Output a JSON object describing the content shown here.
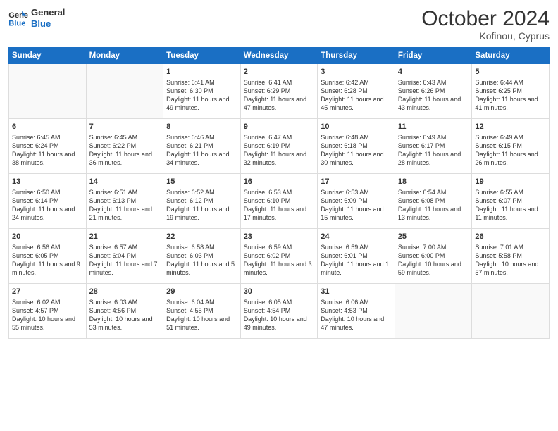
{
  "header": {
    "logo_line1": "General",
    "logo_line2": "Blue",
    "month": "October 2024",
    "location": "Kofinou, Cyprus"
  },
  "days_of_week": [
    "Sunday",
    "Monday",
    "Tuesday",
    "Wednesday",
    "Thursday",
    "Friday",
    "Saturday"
  ],
  "weeks": [
    [
      {
        "day": "",
        "info": ""
      },
      {
        "day": "",
        "info": ""
      },
      {
        "day": "1",
        "info": "Sunrise: 6:41 AM\nSunset: 6:30 PM\nDaylight: 11 hours and 49 minutes."
      },
      {
        "day": "2",
        "info": "Sunrise: 6:41 AM\nSunset: 6:29 PM\nDaylight: 11 hours and 47 minutes."
      },
      {
        "day": "3",
        "info": "Sunrise: 6:42 AM\nSunset: 6:28 PM\nDaylight: 11 hours and 45 minutes."
      },
      {
        "day": "4",
        "info": "Sunrise: 6:43 AM\nSunset: 6:26 PM\nDaylight: 11 hours and 43 minutes."
      },
      {
        "day": "5",
        "info": "Sunrise: 6:44 AM\nSunset: 6:25 PM\nDaylight: 11 hours and 41 minutes."
      }
    ],
    [
      {
        "day": "6",
        "info": "Sunrise: 6:45 AM\nSunset: 6:24 PM\nDaylight: 11 hours and 38 minutes."
      },
      {
        "day": "7",
        "info": "Sunrise: 6:45 AM\nSunset: 6:22 PM\nDaylight: 11 hours and 36 minutes."
      },
      {
        "day": "8",
        "info": "Sunrise: 6:46 AM\nSunset: 6:21 PM\nDaylight: 11 hours and 34 minutes."
      },
      {
        "day": "9",
        "info": "Sunrise: 6:47 AM\nSunset: 6:19 PM\nDaylight: 11 hours and 32 minutes."
      },
      {
        "day": "10",
        "info": "Sunrise: 6:48 AM\nSunset: 6:18 PM\nDaylight: 11 hours and 30 minutes."
      },
      {
        "day": "11",
        "info": "Sunrise: 6:49 AM\nSunset: 6:17 PM\nDaylight: 11 hours and 28 minutes."
      },
      {
        "day": "12",
        "info": "Sunrise: 6:49 AM\nSunset: 6:15 PM\nDaylight: 11 hours and 26 minutes."
      }
    ],
    [
      {
        "day": "13",
        "info": "Sunrise: 6:50 AM\nSunset: 6:14 PM\nDaylight: 11 hours and 24 minutes."
      },
      {
        "day": "14",
        "info": "Sunrise: 6:51 AM\nSunset: 6:13 PM\nDaylight: 11 hours and 21 minutes."
      },
      {
        "day": "15",
        "info": "Sunrise: 6:52 AM\nSunset: 6:12 PM\nDaylight: 11 hours and 19 minutes."
      },
      {
        "day": "16",
        "info": "Sunrise: 6:53 AM\nSunset: 6:10 PM\nDaylight: 11 hours and 17 minutes."
      },
      {
        "day": "17",
        "info": "Sunrise: 6:53 AM\nSunset: 6:09 PM\nDaylight: 11 hours and 15 minutes."
      },
      {
        "day": "18",
        "info": "Sunrise: 6:54 AM\nSunset: 6:08 PM\nDaylight: 11 hours and 13 minutes."
      },
      {
        "day": "19",
        "info": "Sunrise: 6:55 AM\nSunset: 6:07 PM\nDaylight: 11 hours and 11 minutes."
      }
    ],
    [
      {
        "day": "20",
        "info": "Sunrise: 6:56 AM\nSunset: 6:05 PM\nDaylight: 11 hours and 9 minutes."
      },
      {
        "day": "21",
        "info": "Sunrise: 6:57 AM\nSunset: 6:04 PM\nDaylight: 11 hours and 7 minutes."
      },
      {
        "day": "22",
        "info": "Sunrise: 6:58 AM\nSunset: 6:03 PM\nDaylight: 11 hours and 5 minutes."
      },
      {
        "day": "23",
        "info": "Sunrise: 6:59 AM\nSunset: 6:02 PM\nDaylight: 11 hours and 3 minutes."
      },
      {
        "day": "24",
        "info": "Sunrise: 6:59 AM\nSunset: 6:01 PM\nDaylight: 11 hours and 1 minute."
      },
      {
        "day": "25",
        "info": "Sunrise: 7:00 AM\nSunset: 6:00 PM\nDaylight: 10 hours and 59 minutes."
      },
      {
        "day": "26",
        "info": "Sunrise: 7:01 AM\nSunset: 5:58 PM\nDaylight: 10 hours and 57 minutes."
      }
    ],
    [
      {
        "day": "27",
        "info": "Sunrise: 6:02 AM\nSunset: 4:57 PM\nDaylight: 10 hours and 55 minutes."
      },
      {
        "day": "28",
        "info": "Sunrise: 6:03 AM\nSunset: 4:56 PM\nDaylight: 10 hours and 53 minutes."
      },
      {
        "day": "29",
        "info": "Sunrise: 6:04 AM\nSunset: 4:55 PM\nDaylight: 10 hours and 51 minutes."
      },
      {
        "day": "30",
        "info": "Sunrise: 6:05 AM\nSunset: 4:54 PM\nDaylight: 10 hours and 49 minutes."
      },
      {
        "day": "31",
        "info": "Sunrise: 6:06 AM\nSunset: 4:53 PM\nDaylight: 10 hours and 47 minutes."
      },
      {
        "day": "",
        "info": ""
      },
      {
        "day": "",
        "info": ""
      }
    ]
  ]
}
